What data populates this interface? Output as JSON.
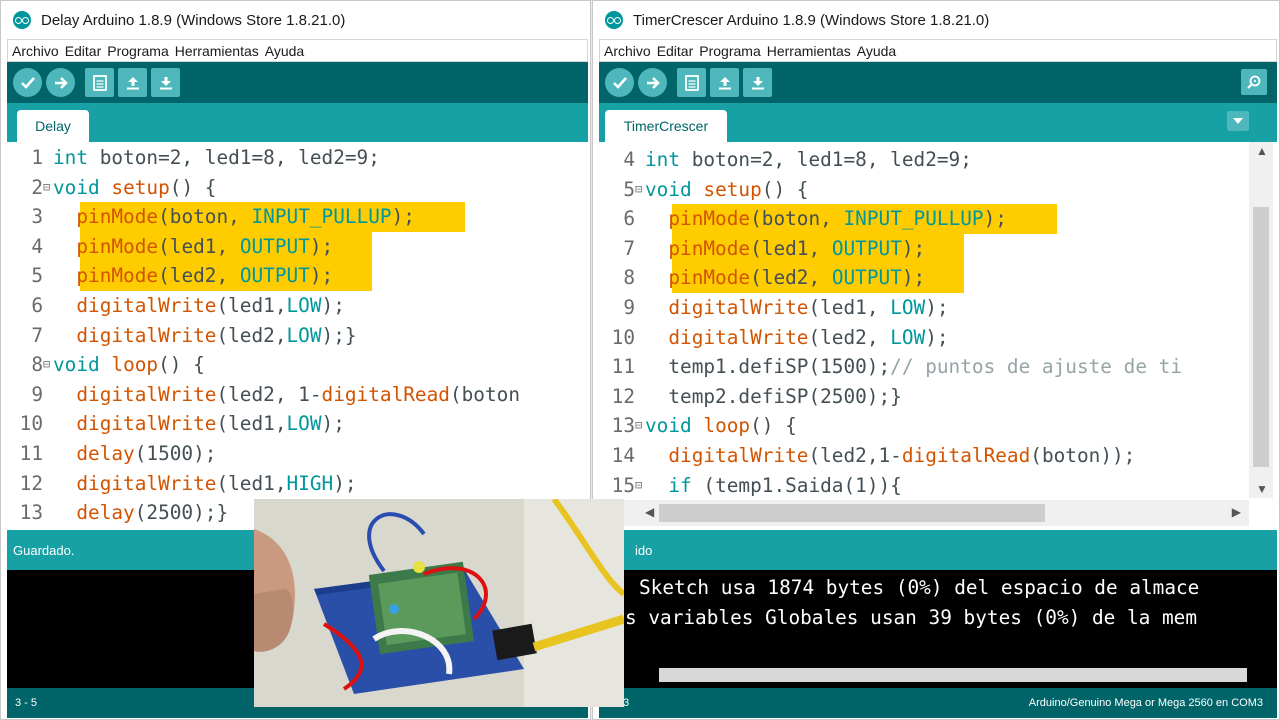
{
  "left_window": {
    "title": "Delay Arduino 1.8.9 (Windows Store 1.8.21.0)",
    "menu": [
      "Archivo",
      "Editar",
      "Programa",
      "Herramientas",
      "Ayuda"
    ],
    "tab": "Delay",
    "code": [
      {
        "n": "1",
        "fold": false,
        "hl": false,
        "segs": [
          [
            "k",
            "int"
          ],
          [
            "p",
            " boton=2, led1=8, led2=9;"
          ]
        ]
      },
      {
        "n": "2",
        "fold": true,
        "hl": false,
        "segs": [
          [
            "k",
            "void"
          ],
          [
            "p",
            " "
          ],
          [
            "f",
            "setup"
          ],
          [
            "p",
            "() {"
          ]
        ]
      },
      {
        "n": "3",
        "fold": false,
        "hl": true,
        "segs": [
          [
            "p",
            "  "
          ],
          [
            "f",
            "pinMode"
          ],
          [
            "p",
            "(boton, "
          ],
          [
            "c",
            "INPUT_PULLUP"
          ],
          [
            "p",
            ");"
          ]
        ]
      },
      {
        "n": "4",
        "fold": false,
        "hl": true,
        "segs": [
          [
            "p",
            "  "
          ],
          [
            "f",
            "pinMode"
          ],
          [
            "p",
            "(led1, "
          ],
          [
            "c",
            "OUTPUT"
          ],
          [
            "p",
            ");"
          ]
        ]
      },
      {
        "n": "5",
        "fold": false,
        "hl": true,
        "segs": [
          [
            "p",
            "  "
          ],
          [
            "f",
            "pinMode"
          ],
          [
            "p",
            "(led2, "
          ],
          [
            "c",
            "OUTPUT"
          ],
          [
            "p",
            ");"
          ]
        ]
      },
      {
        "n": "6",
        "fold": false,
        "hl": false,
        "segs": [
          [
            "p",
            "  "
          ],
          [
            "f",
            "digitalWrite"
          ],
          [
            "p",
            "(led1,"
          ],
          [
            "c",
            "LOW"
          ],
          [
            "p",
            ");"
          ]
        ]
      },
      {
        "n": "7",
        "fold": false,
        "hl": false,
        "segs": [
          [
            "p",
            "  "
          ],
          [
            "f",
            "digitalWrite"
          ],
          [
            "p",
            "(led2,"
          ],
          [
            "c",
            "LOW"
          ],
          [
            "p",
            ");}"
          ]
        ]
      },
      {
        "n": "8",
        "fold": true,
        "hl": false,
        "segs": [
          [
            "k",
            "void"
          ],
          [
            "p",
            " "
          ],
          [
            "f",
            "loop"
          ],
          [
            "p",
            "() {"
          ]
        ]
      },
      {
        "n": "9",
        "fold": false,
        "hl": false,
        "segs": [
          [
            "p",
            "  "
          ],
          [
            "f",
            "digitalWrite"
          ],
          [
            "p",
            "(led2, 1-"
          ],
          [
            "f",
            "digitalRead"
          ],
          [
            "p",
            "(boton"
          ]
        ]
      },
      {
        "n": "10",
        "fold": false,
        "hl": false,
        "segs": [
          [
            "p",
            "  "
          ],
          [
            "f",
            "digitalWrite"
          ],
          [
            "p",
            "(led1,"
          ],
          [
            "c",
            "LOW"
          ],
          [
            "p",
            ");"
          ]
        ]
      },
      {
        "n": "11",
        "fold": false,
        "hl": false,
        "segs": [
          [
            "p",
            "  "
          ],
          [
            "f",
            "delay"
          ],
          [
            "p",
            "(1500);"
          ]
        ]
      },
      {
        "n": "12",
        "fold": false,
        "hl": false,
        "segs": [
          [
            "p",
            "  "
          ],
          [
            "f",
            "digitalWrite"
          ],
          [
            "p",
            "(led1,"
          ],
          [
            "c",
            "HIGH"
          ],
          [
            "p",
            ");"
          ]
        ]
      },
      {
        "n": "13",
        "fold": false,
        "hl": false,
        "segs": [
          [
            "p",
            "  "
          ],
          [
            "f",
            "delay"
          ],
          [
            "p",
            "(2500);}"
          ]
        ]
      }
    ],
    "status": "Guardado.",
    "footer_left": "3 - 5"
  },
  "right_window": {
    "title": "TimerCrescer Arduino 1.8.9 (Windows Store 1.8.21.0)",
    "menu": [
      "Archivo",
      "Editar",
      "Programa",
      "Herramientas",
      "Ayuda"
    ],
    "tab": "TimerCrescer",
    "code": [
      {
        "n": "4",
        "fold": false,
        "hl": false,
        "segs": [
          [
            "k",
            "int"
          ],
          [
            "p",
            " boton=2, led1=8, led2=9;"
          ]
        ]
      },
      {
        "n": "5",
        "fold": true,
        "hl": false,
        "segs": [
          [
            "k",
            "void"
          ],
          [
            "p",
            " "
          ],
          [
            "f",
            "setup"
          ],
          [
            "p",
            "() {"
          ]
        ]
      },
      {
        "n": "6",
        "fold": false,
        "hl": true,
        "segs": [
          [
            "p",
            "  "
          ],
          [
            "f",
            "pinMode"
          ],
          [
            "p",
            "(boton, "
          ],
          [
            "c",
            "INPUT_PULLUP"
          ],
          [
            "p",
            ");"
          ]
        ]
      },
      {
        "n": "7",
        "fold": false,
        "hl": true,
        "segs": [
          [
            "p",
            "  "
          ],
          [
            "f",
            "pinMode"
          ],
          [
            "p",
            "(led1, "
          ],
          [
            "c",
            "OUTPUT"
          ],
          [
            "p",
            ");"
          ]
        ]
      },
      {
        "n": "8",
        "fold": false,
        "hl": true,
        "segs": [
          [
            "p",
            "  "
          ],
          [
            "f",
            "pinMode"
          ],
          [
            "p",
            "(led2, "
          ],
          [
            "c",
            "OUTPUT"
          ],
          [
            "p",
            ");"
          ]
        ]
      },
      {
        "n": "9",
        "fold": false,
        "hl": false,
        "segs": [
          [
            "p",
            "  "
          ],
          [
            "f",
            "digitalWrite"
          ],
          [
            "p",
            "(led1, "
          ],
          [
            "c",
            "LOW"
          ],
          [
            "p",
            ");"
          ]
        ]
      },
      {
        "n": "10",
        "fold": false,
        "hl": false,
        "segs": [
          [
            "p",
            "  "
          ],
          [
            "f",
            "digitalWrite"
          ],
          [
            "p",
            "(led2, "
          ],
          [
            "c",
            "LOW"
          ],
          [
            "p",
            ");"
          ]
        ]
      },
      {
        "n": "11",
        "fold": false,
        "hl": false,
        "segs": [
          [
            "p",
            "  temp1.defiSP(1500);"
          ],
          [
            "cm",
            "// puntos de ajuste de ti"
          ]
        ]
      },
      {
        "n": "12",
        "fold": false,
        "hl": false,
        "segs": [
          [
            "p",
            "  temp2.defiSP(2500);}"
          ]
        ]
      },
      {
        "n": "13",
        "fold": true,
        "hl": false,
        "segs": [
          [
            "k",
            "void"
          ],
          [
            "p",
            " "
          ],
          [
            "f",
            "loop"
          ],
          [
            "p",
            "() {"
          ]
        ]
      },
      {
        "n": "14",
        "fold": false,
        "hl": false,
        "segs": [
          [
            "p",
            "  "
          ],
          [
            "f",
            "digitalWrite"
          ],
          [
            "p",
            "(led2,1-"
          ],
          [
            "f",
            "digitalRead"
          ],
          [
            "p",
            "(boton));"
          ]
        ]
      },
      {
        "n": "15",
        "fold": true,
        "hl": false,
        "segs": [
          [
            "p",
            "  "
          ],
          [
            "k",
            "if"
          ],
          [
            "p",
            " (temp1.Saida(1)){"
          ]
        ]
      }
    ],
    "status": "ido",
    "console": [
      "Sketch usa 1874 bytes (0%) del espacio de almace",
      "s variables Globales usan 39 bytes (0%) de la mem"
    ],
    "footer_right": "Arduino/Genuino Mega or Mega 2560 en COM3",
    "footer_left": "3"
  },
  "colors": {
    "toolbar": "#006468",
    "tabbar": "#17a1a5",
    "button": "#4db7bb",
    "highlight": "#ffcc00",
    "keyword": "#00979c",
    "function": "#d35400"
  },
  "icons": [
    "arduino-logo-icon",
    "verify-check-icon",
    "upload-arrow-icon",
    "new-file-icon",
    "open-file-icon",
    "save-file-icon",
    "serial-monitor-icon",
    "tab-menu-icon"
  ]
}
